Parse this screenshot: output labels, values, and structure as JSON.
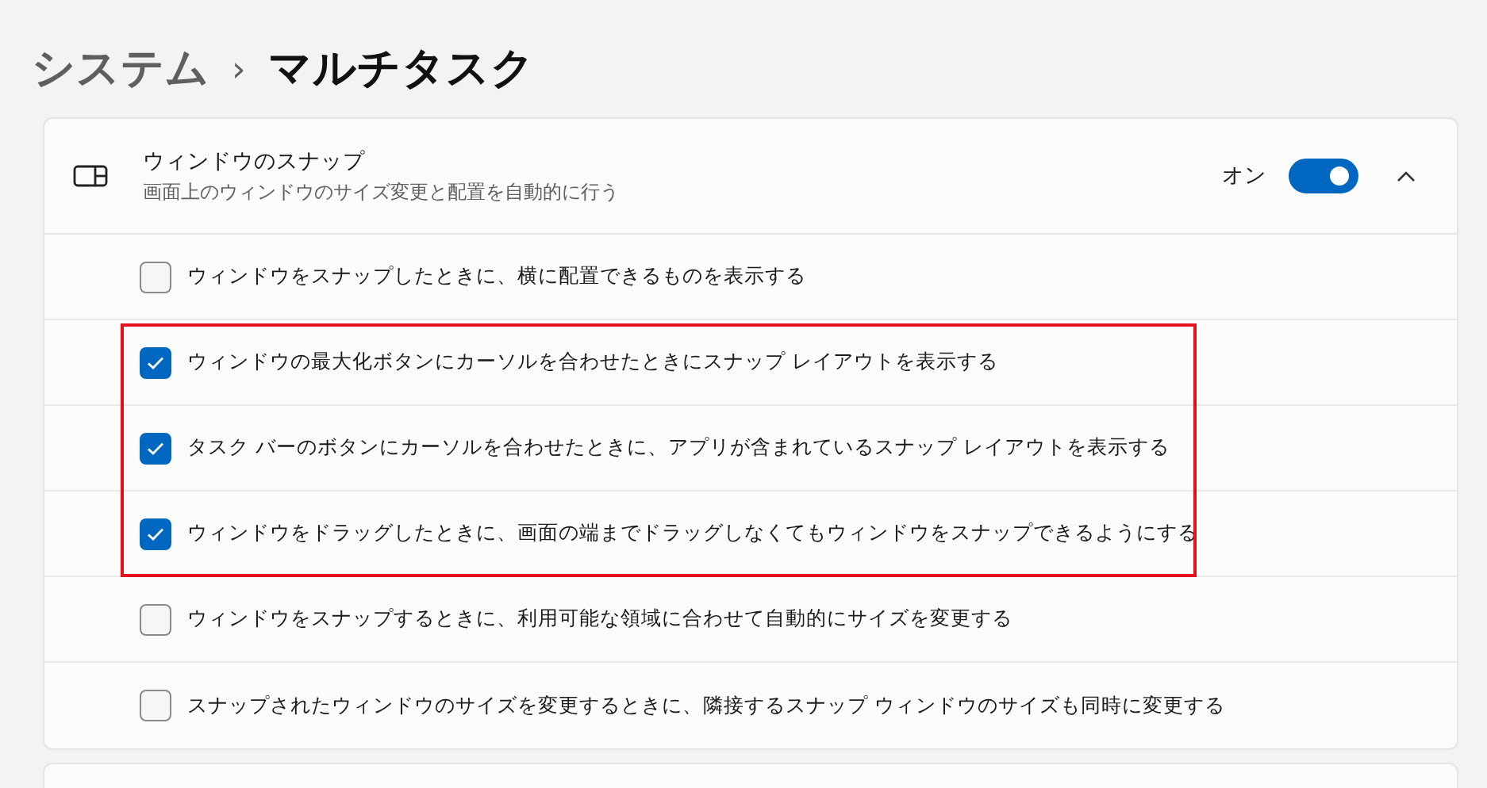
{
  "breadcrumb": {
    "items": [
      {
        "text": "システム",
        "current": false
      },
      {
        "text": "マルチタスク",
        "current": true
      }
    ],
    "separator": "›"
  },
  "section": {
    "title": "ウィンドウのスナップ",
    "description": "画面上のウィンドウのサイズ変更と配置を自動的に行う",
    "toggle_label": "オン",
    "on": true,
    "expanded": true,
    "options": [
      {
        "label": "ウィンドウをスナップしたときに、横に配置できるものを表示する",
        "checked": false,
        "highlighted": false
      },
      {
        "label": "ウィンドウの最大化ボタンにカーソルを合わせたときにスナップ レイアウトを表示する",
        "checked": true,
        "highlighted": true
      },
      {
        "label": "タスク バーのボタンにカーソルを合わせたときに、アプリが含まれているスナップ レイアウトを表示する",
        "checked": true,
        "highlighted": true
      },
      {
        "label": "ウィンドウをドラッグしたときに、画面の端までドラッグしなくてもウィンドウをスナップできるようにする",
        "checked": true,
        "highlighted": true
      },
      {
        "label": "ウィンドウをスナップするときに、利用可能な領域に合わせて自動的にサイズを変更する",
        "checked": false,
        "highlighted": false
      },
      {
        "label": "スナップされたウィンドウのサイズを変更するときに、隣接するスナップ ウィンドウのサイズも同時に変更する",
        "checked": false,
        "highlighted": false
      }
    ]
  }
}
